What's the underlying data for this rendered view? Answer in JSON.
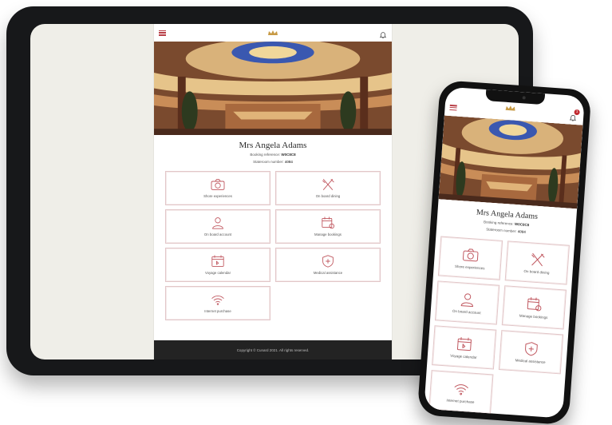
{
  "app": {
    "guest_name": "Mrs Angela Adams",
    "booking_label": "Booking reference:",
    "booking_value": "W0C8C8",
    "room_label": "Stateroom number:",
    "room_value": "4084",
    "footer": "Copyright © Cunard 2021. All rights reserved.",
    "notification_count": "1"
  },
  "tiles": [
    {
      "label": "Shore experiences",
      "icon": "camera-icon"
    },
    {
      "label": "On board dining",
      "icon": "cutlery-icon"
    },
    {
      "label": "On board account",
      "icon": "user-icon"
    },
    {
      "label": "Manage bookings",
      "icon": "calendar-settings-icon"
    },
    {
      "label": "Voyage calendar",
      "icon": "calendar-icon"
    },
    {
      "label": "Medical assistance",
      "icon": "medical-shield-icon"
    },
    {
      "label": "Internet purchase",
      "icon": "wifi-icon"
    }
  ],
  "colors": {
    "accent": "#b83e46",
    "tile_border": "#e2c6c8",
    "footer_bg": "#232323",
    "screen_bg": "#efeee8"
  }
}
